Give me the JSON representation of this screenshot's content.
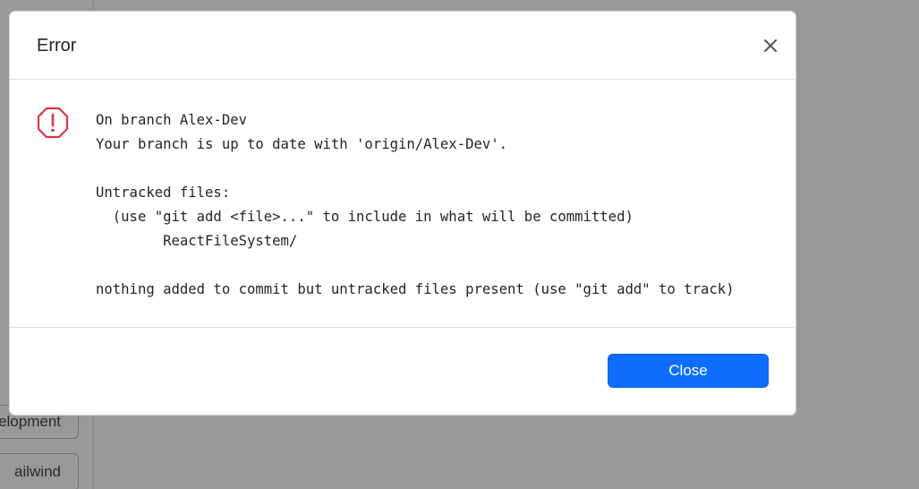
{
  "background": {
    "sidebar_buttons": [
      "elopment",
      "ailwind"
    ]
  },
  "modal": {
    "title": "Error",
    "close_icon": "close-icon",
    "status_icon": "octagon-exclamation-icon",
    "status_color": "#dc3545",
    "output_lines": [
      "On branch Alex-Dev",
      "Your branch is up to date with 'origin/Alex-Dev'.",
      "",
      "Untracked files:",
      "  (use \"git add <file>...\" to include in what will be committed)",
      "        ReactFileSystem/",
      "",
      "nothing added to commit but untracked files present (use \"git add\" to track)"
    ],
    "close_button_label": "Close",
    "accent_color": "#0d6efd"
  }
}
